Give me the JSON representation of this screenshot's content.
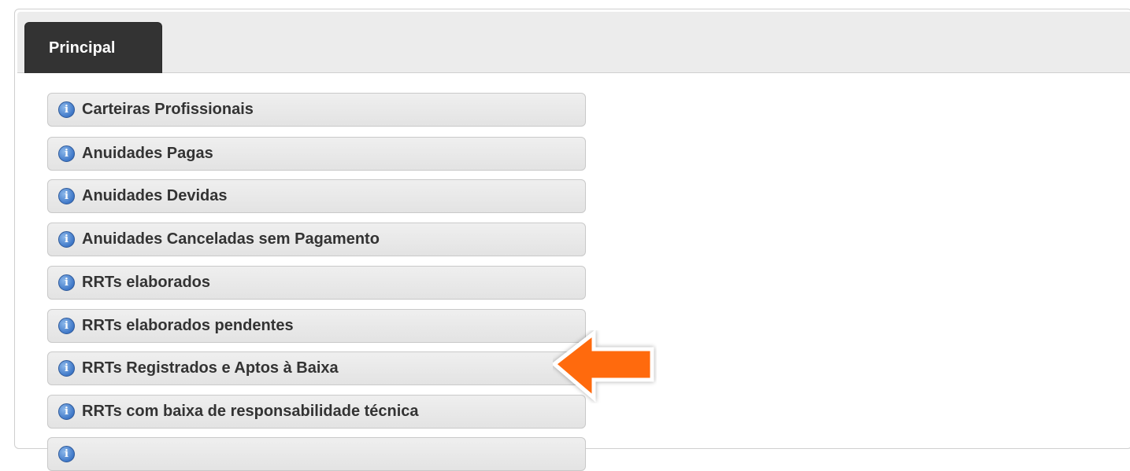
{
  "tabs": [
    {
      "label": "Principal",
      "active": true
    }
  ],
  "menu_items": [
    {
      "label": "Carteiras Profissionais",
      "icon": "info-icon"
    },
    {
      "label": "Anuidades Pagas",
      "icon": "info-icon"
    },
    {
      "label": "Anuidades Devidas",
      "icon": "info-icon"
    },
    {
      "label": "Anuidades Canceladas sem Pagamento",
      "icon": "info-icon"
    },
    {
      "label": "RRTs elaborados",
      "icon": "info-icon"
    },
    {
      "label": "RRTs elaborados pendentes",
      "icon": "info-icon"
    },
    {
      "label": "RRTs Registrados e Aptos à Baixa",
      "icon": "info-icon"
    },
    {
      "label": "RRTs com baixa de responsabilidade técnica",
      "icon": "info-icon"
    },
    {
      "label": "",
      "icon": "info-icon"
    }
  ],
  "icon_glyph": "i",
  "annotation": {
    "icon": "orange-arrow-pointer",
    "color": "#ff6a0d",
    "points_to_item": 6
  },
  "colors": {
    "tab_active": "#333333",
    "icon_blue": "#3f78c8",
    "arrow_orange": "#ff6a0d"
  }
}
